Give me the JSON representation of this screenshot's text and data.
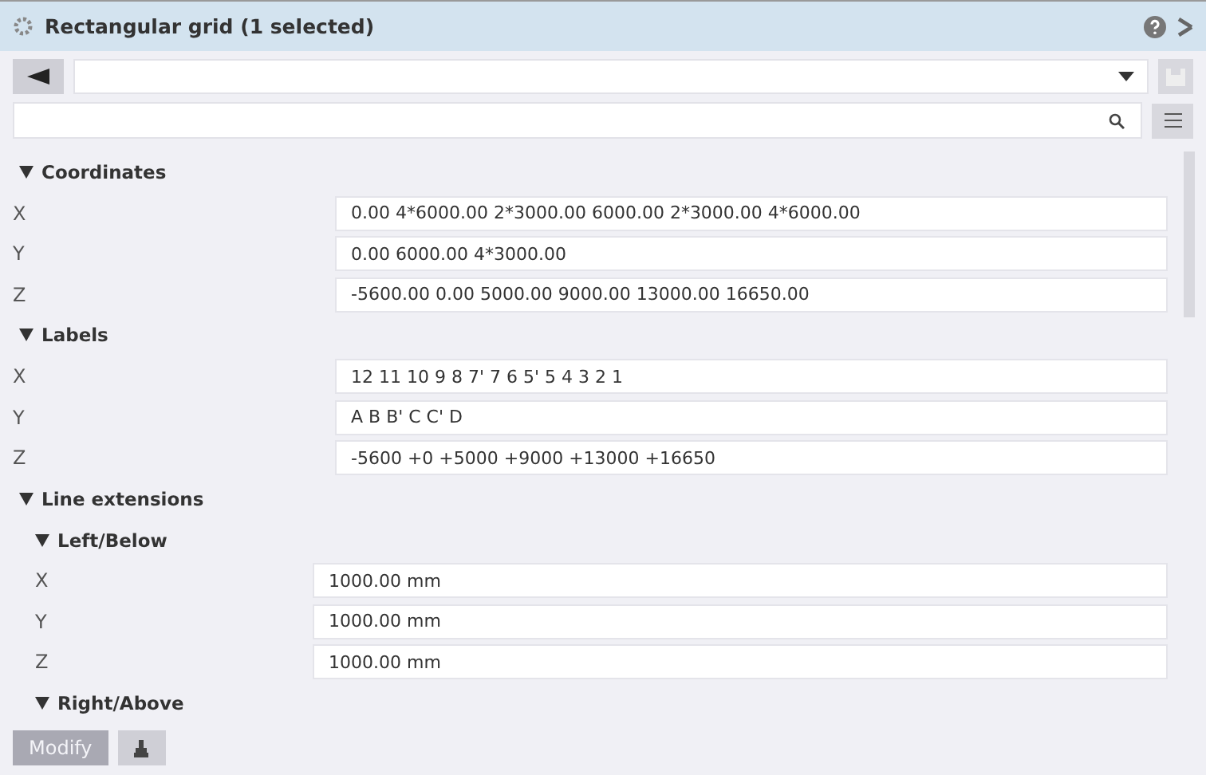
{
  "window": {
    "title": "Rectangular grid (1 selected)"
  },
  "sections": [
    {
      "title": "Coordinates",
      "expanded": true,
      "fields": [
        {
          "label": "X",
          "value": "0.00 4*6000.00 2*3000.00 6000.00 2*3000.00 4*6000.00"
        },
        {
          "label": "Y",
          "value": "0.00 6000.00 4*3000.00"
        },
        {
          "label": "Z",
          "value": "-5600.00 0.00 5000.00 9000.00 13000.00 16650.00"
        }
      ]
    },
    {
      "title": "Labels",
      "expanded": true,
      "fields": [
        {
          "label": "X",
          "value": "12 11 10 9 8 7' 7 6 5' 5 4 3 2 1"
        },
        {
          "label": "Y",
          "value": "A B B' C C' D"
        },
        {
          "label": "Z",
          "value": "-5600 +0 +5000 +9000 +13000 +16650"
        }
      ]
    },
    {
      "title": "Line extensions",
      "expanded": true,
      "children": [
        {
          "title": "Left/Below",
          "expanded": true,
          "fields": [
            {
              "label": "X",
              "value": "1000.00 mm"
            },
            {
              "label": "Y",
              "value": "1000.00 mm"
            },
            {
              "label": "Z",
              "value": "1000.00 mm"
            }
          ]
        },
        {
          "title": "Right/Above",
          "expanded": true
        }
      ]
    }
  ],
  "footer": {
    "modify": {
      "label": "Modify",
      "disabled": true
    }
  }
}
